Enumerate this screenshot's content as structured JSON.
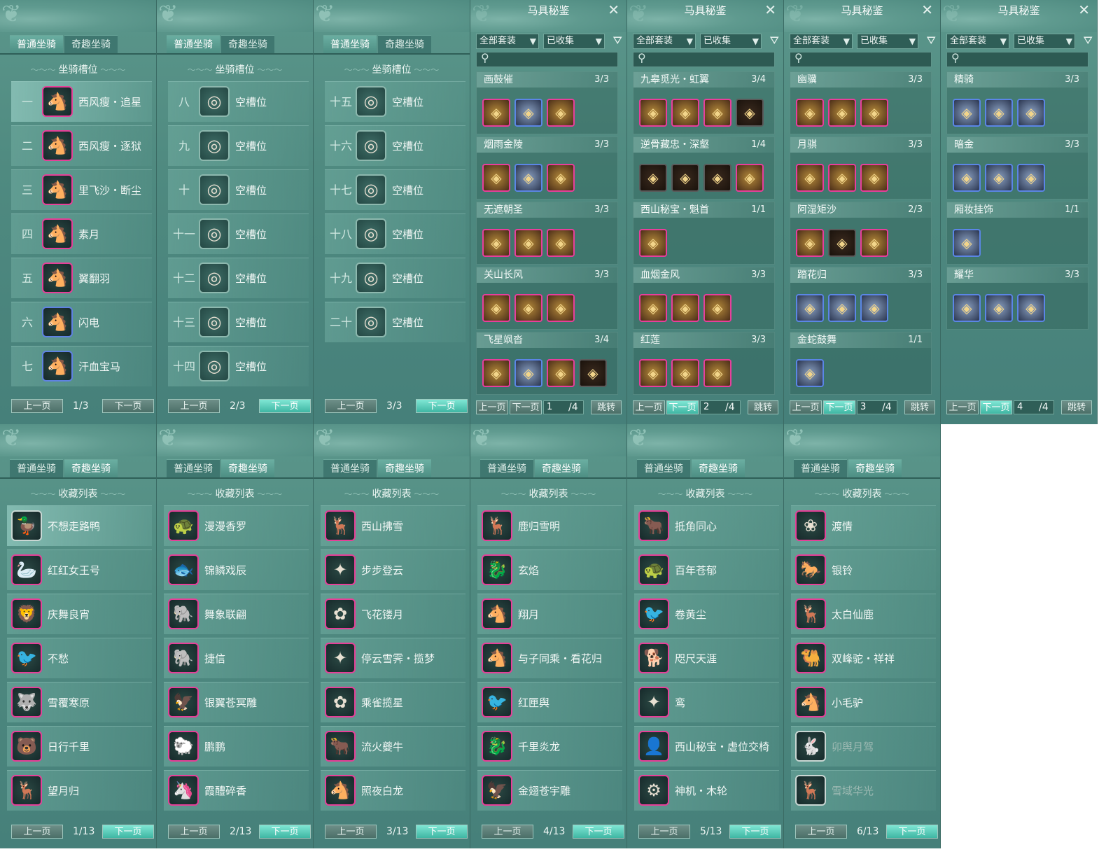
{
  "labels": {
    "tab_normal": "普通坐骑",
    "tab_fun": "奇趣坐骑",
    "slot_section": "坐骑槽位",
    "collection_section": "收藏列表",
    "prev": "上一页",
    "next": "下一页",
    "jump": "跳转",
    "saddle_title": "马具秘鉴",
    "filter_all_sets": "全部套装",
    "filter_collected": "已收集",
    "empty_slot": "空槽位"
  },
  "slot_panels": [
    {
      "page": "1/3",
      "slots": [
        {
          "num": "一",
          "name": "西风瘦・追星",
          "frame": "pink",
          "glyph": "🐴",
          "selected": true
        },
        {
          "num": "二",
          "name": "西风瘦・逐狱",
          "frame": "pink",
          "glyph": "🐴"
        },
        {
          "num": "三",
          "name": "里飞沙・断尘",
          "frame": "pink",
          "glyph": "🐴"
        },
        {
          "num": "四",
          "name": "素月",
          "frame": "pink",
          "glyph": "🐴"
        },
        {
          "num": "五",
          "name": "翼翻羽",
          "frame": "pink",
          "glyph": "🐴"
        },
        {
          "num": "六",
          "name": "闪电",
          "frame": "blue",
          "glyph": "🐴"
        },
        {
          "num": "七",
          "name": "汗血宝马",
          "frame": "blue",
          "glyph": "🐴"
        }
      ]
    },
    {
      "page": "2/3",
      "slots": [
        {
          "num": "八",
          "name": "空槽位",
          "frame": "empty",
          "glyph": "◎"
        },
        {
          "num": "九",
          "name": "空槽位",
          "frame": "empty",
          "glyph": "◎"
        },
        {
          "num": "十",
          "name": "空槽位",
          "frame": "empty",
          "glyph": "◎"
        },
        {
          "num": "十一",
          "name": "空槽位",
          "frame": "empty",
          "glyph": "◎"
        },
        {
          "num": "十二",
          "name": "空槽位",
          "frame": "empty",
          "glyph": "◎"
        },
        {
          "num": "十三",
          "name": "空槽位",
          "frame": "empty",
          "glyph": "◎"
        },
        {
          "num": "十四",
          "name": "空槽位",
          "frame": "empty",
          "glyph": "◎"
        }
      ]
    },
    {
      "page": "3/3",
      "slots": [
        {
          "num": "十五",
          "name": "空槽位",
          "frame": "empty",
          "glyph": "◎"
        },
        {
          "num": "十六",
          "name": "空槽位",
          "frame": "empty",
          "glyph": "◎"
        },
        {
          "num": "十七",
          "name": "空槽位",
          "frame": "empty",
          "glyph": "◎"
        },
        {
          "num": "十八",
          "name": "空槽位",
          "frame": "empty",
          "glyph": "◎"
        },
        {
          "num": "十九",
          "name": "空槽位",
          "frame": "empty",
          "glyph": "◎"
        },
        {
          "num": "二十",
          "name": "空槽位",
          "frame": "empty",
          "glyph": "◎"
        }
      ]
    }
  ],
  "saddle_panels": [
    {
      "page": "1",
      "total": "/4",
      "groups": [
        {
          "name": "画鼓催",
          "count": "3/3",
          "items": [
            "pink",
            "blue",
            "pink"
          ]
        },
        {
          "name": "烟雨金陵",
          "count": "3/3",
          "items": [
            "pink",
            "blue",
            "pink"
          ]
        },
        {
          "name": "无遮朝圣",
          "count": "3/3",
          "items": [
            "pink",
            "pink",
            "pink"
          ]
        },
        {
          "name": "关山长风",
          "count": "3/3",
          "items": [
            "pink",
            "pink",
            "pink"
          ]
        },
        {
          "name": "飞星飒沓",
          "count": "3/4",
          "items": [
            "pink",
            "blue",
            "pink",
            "dark"
          ]
        }
      ]
    },
    {
      "page": "2",
      "total": "/4",
      "groups": [
        {
          "name": "九皋觅光・虹翼",
          "count": "3/4",
          "items": [
            "pink",
            "pink",
            "pink",
            "dark"
          ]
        },
        {
          "name": "逆骨藏忠・深壑",
          "count": "1/4",
          "items": [
            "dark",
            "dark",
            "dark",
            "pink"
          ]
        },
        {
          "name": "西山秘宝・魁首",
          "count": "1/1",
          "items": [
            "pink"
          ]
        },
        {
          "name": "血烟金风",
          "count": "3/3",
          "items": [
            "pink",
            "pink",
            "pink"
          ]
        },
        {
          "name": "红莲",
          "count": "3/3",
          "items": [
            "pink",
            "pink",
            "pink"
          ]
        }
      ]
    },
    {
      "page": "3",
      "total": "/4",
      "groups": [
        {
          "name": "幽骥",
          "count": "3/3",
          "items": [
            "pink",
            "pink",
            "pink"
          ]
        },
        {
          "name": "月骐",
          "count": "3/3",
          "items": [
            "pink",
            "pink",
            "pink"
          ]
        },
        {
          "name": "阿湿矩沙",
          "count": "2/3",
          "items": [
            "pink",
            "dark",
            "pink"
          ]
        },
        {
          "name": "踏花归",
          "count": "3/3",
          "items": [
            "blue",
            "blue",
            "blue"
          ]
        },
        {
          "name": "金蛇鼓舞",
          "count": "1/1",
          "items": [
            "blue"
          ]
        }
      ]
    },
    {
      "page": "4",
      "total": "/4",
      "groups": [
        {
          "name": "精骑",
          "count": "3/3",
          "items": [
            "blue",
            "blue",
            "blue"
          ]
        },
        {
          "name": "暗金",
          "count": "3/3",
          "items": [
            "blue",
            "blue",
            "blue"
          ]
        },
        {
          "name": "厢妆挂饰",
          "count": "1/1",
          "items": [
            "blue"
          ]
        },
        {
          "name": "耀华",
          "count": "3/3",
          "items": [
            "blue",
            "blue",
            "blue"
          ]
        }
      ]
    }
  ],
  "fun_panels": [
    {
      "page": "1/13",
      "items": [
        {
          "name": "不想走路鸭",
          "frame": "plain",
          "glyph": "🦆",
          "selected": true
        },
        {
          "name": "红红女王号",
          "frame": "pink",
          "glyph": "🦢"
        },
        {
          "name": "庆舞良宵",
          "frame": "pink",
          "glyph": "🦁"
        },
        {
          "name": "不愁",
          "frame": "pink",
          "glyph": "🐦"
        },
        {
          "name": "雪覆寒原",
          "frame": "pink",
          "glyph": "🐺"
        },
        {
          "name": "日行千里",
          "frame": "pink",
          "glyph": "🐻"
        },
        {
          "name": "望月归",
          "frame": "pink",
          "glyph": "🦌"
        }
      ]
    },
    {
      "page": "2/13",
      "items": [
        {
          "name": "漫漫香罗",
          "frame": "pink",
          "glyph": "🐢"
        },
        {
          "name": "锦鳞戏辰",
          "frame": "pink",
          "glyph": "🐟"
        },
        {
          "name": "舞象联翩",
          "frame": "pink",
          "glyph": "🐘"
        },
        {
          "name": "捷信",
          "frame": "pink",
          "glyph": "🐘"
        },
        {
          "name": "银翼苍冥雕",
          "frame": "pink",
          "glyph": "🦅"
        },
        {
          "name": "鹏鹏",
          "frame": "pink",
          "glyph": "🐑"
        },
        {
          "name": "霞醴碎香",
          "frame": "pink",
          "glyph": "🦄"
        }
      ]
    },
    {
      "page": "3/13",
      "items": [
        {
          "name": "西山拂雪",
          "frame": "pink",
          "glyph": "🦌"
        },
        {
          "name": "步步登云",
          "frame": "pink",
          "glyph": "✦"
        },
        {
          "name": "飞花镂月",
          "frame": "pink",
          "glyph": "✿"
        },
        {
          "name": "停云雪霁・揽梦",
          "frame": "pink",
          "glyph": "✦"
        },
        {
          "name": "乘雀揽星",
          "frame": "pink",
          "glyph": "✿"
        },
        {
          "name": "流火夔牛",
          "frame": "pink",
          "glyph": "🐂"
        },
        {
          "name": "照夜白龙",
          "frame": "pink",
          "glyph": "🐴"
        }
      ]
    },
    {
      "page": "4/13",
      "items": [
        {
          "name": "鹿归雪明",
          "frame": "pink",
          "glyph": "🦌"
        },
        {
          "name": "玄焰",
          "frame": "pink",
          "glyph": "🐉"
        },
        {
          "name": "翔月",
          "frame": "pink",
          "glyph": "🐴"
        },
        {
          "name": "与子同乘・看花归",
          "frame": "pink",
          "glyph": "🐴"
        },
        {
          "name": "红匣舆",
          "frame": "pink",
          "glyph": "🐦"
        },
        {
          "name": "千里炎龙",
          "frame": "pink",
          "glyph": "🐉"
        },
        {
          "name": "金翅苍宇雕",
          "frame": "pink",
          "glyph": "🦅"
        }
      ]
    },
    {
      "page": "5/13",
      "items": [
        {
          "name": "抵角同心",
          "frame": "pink",
          "glyph": "🐂"
        },
        {
          "name": "百年苍郁",
          "frame": "pink",
          "glyph": "🐢"
        },
        {
          "name": "卷黄尘",
          "frame": "pink",
          "glyph": "🐦"
        },
        {
          "name": "咫尺天涯",
          "frame": "pink",
          "glyph": "🐕"
        },
        {
          "name": "鸾",
          "frame": "pink",
          "glyph": "✦"
        },
        {
          "name": "西山秘宝・虚位交椅",
          "frame": "pink",
          "glyph": "👤"
        },
        {
          "name": "神机・木轮",
          "frame": "pink",
          "glyph": "⚙"
        }
      ]
    },
    {
      "page": "6/13",
      "items": [
        {
          "name": "渡情",
          "frame": "pink",
          "glyph": "❀"
        },
        {
          "name": "银铃",
          "frame": "pink",
          "glyph": "🐎"
        },
        {
          "name": "太白仙鹿",
          "frame": "pink",
          "glyph": "🦌"
        },
        {
          "name": "双峰驼・祥祥",
          "frame": "pink",
          "glyph": "🐫"
        },
        {
          "name": "小毛驴",
          "frame": "pink",
          "glyph": "🐴"
        },
        {
          "name": "卯舆月驾",
          "frame": "plain",
          "glyph": "🐇",
          "dim": true
        },
        {
          "name": "雪域华光",
          "frame": "plain",
          "glyph": "🦌",
          "dim": true
        }
      ]
    }
  ]
}
